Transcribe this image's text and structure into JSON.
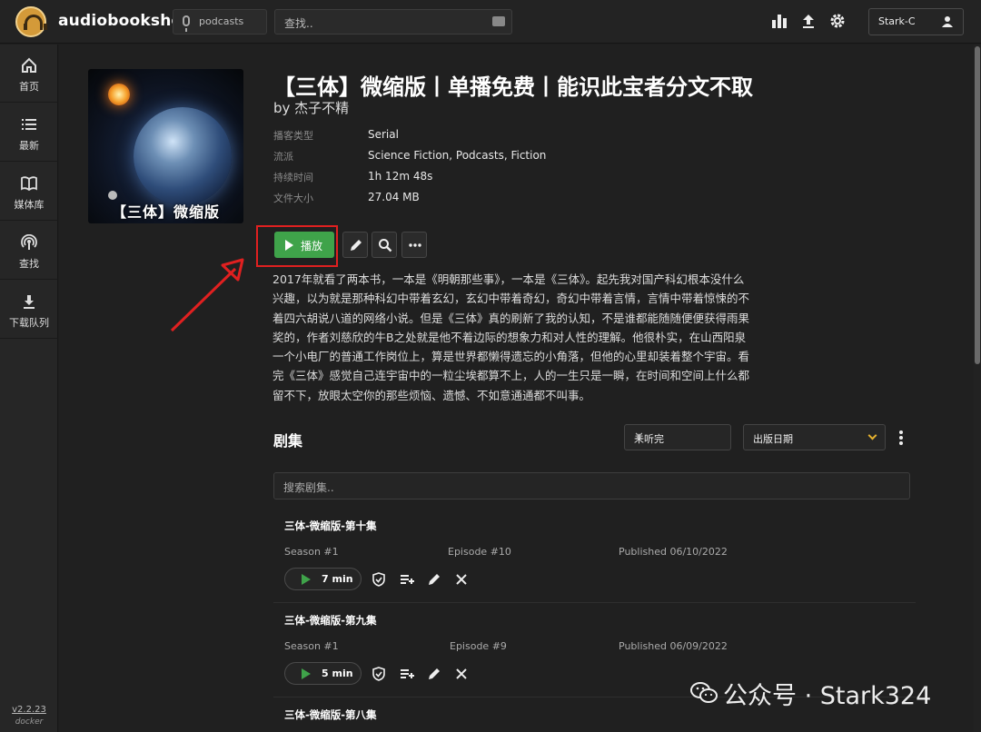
{
  "app": {
    "title": "audiobookshelf",
    "version": "v2.2.23",
    "platform": "docker"
  },
  "topbar": {
    "library": "podcasts",
    "search_placeholder": "查找..",
    "user": "Stark-C"
  },
  "sidebar": {
    "items": [
      {
        "label": "首页",
        "icon": "home-icon"
      },
      {
        "label": "最新",
        "icon": "list-icon"
      },
      {
        "label": "媒体库",
        "icon": "book-icon"
      },
      {
        "label": "查找",
        "icon": "podcast-search-icon"
      },
      {
        "label": "下载队列",
        "icon": "download-icon"
      }
    ]
  },
  "podcast": {
    "cover_caption": "【三体】微缩版",
    "title": "【三体】微缩版丨单播免费丨能识此宝者分文不取",
    "author": "by 杰子不精",
    "meta": [
      {
        "key": "播客类型",
        "value": "Serial"
      },
      {
        "key": "流派",
        "value": "Science Fiction, Podcasts, Fiction"
      },
      {
        "key": "持续时间",
        "value": "1h 12m 48s"
      },
      {
        "key": "文件大小",
        "value": "27.04 MB"
      }
    ],
    "play_label": "播放",
    "description_lines": [
      "2017年就看了两本书，一本是《明朝那些事》，一本是《三体》。起先我对国产科幻根本没什么",
      "兴趣，以为就是那种科幻中带着玄幻，玄幻中带着奇幻，奇幻中带着言情，言情中带着惊悚的不",
      "着四六胡说八道的网络小说。但是《三体》真的刷新了我的认知，不是谁都能随随便便获得雨果",
      "奖的，作者刘慈欣的牛B之处就是他不着边际的想象力和对人性的理解。他很朴实，在山西阳泉",
      "一个小电厂的普通工作岗位上，算是世界都懒得遗忘的小角落，但他的心里却装着整个宇宙。看",
      "完《三体》感觉自己连宇宙中的一粒尘埃都算不上，人的一生只是一瞬，在时间和空间上什么都",
      "留不下，放眼太空你的那些烦恼、遗憾、不如意通通都不叫事。"
    ]
  },
  "episodes": {
    "heading": "剧集",
    "filter": "未听完",
    "sort": "出版日期",
    "search_placeholder": "搜索剧集..",
    "items": [
      {
        "title": "三体-微缩版-第十集",
        "season": "Season #1",
        "episode": "Episode #10",
        "published": "Published 06/10/2022",
        "duration": "7 min"
      },
      {
        "title": "三体-微缩版-第九集",
        "season": "Season #1",
        "episode": "Episode #9",
        "published": "Published 06/09/2022",
        "duration": "5 min"
      },
      {
        "title": "三体-微缩版-第八集"
      }
    ]
  },
  "watermark": "公众号 · Stark324",
  "colors": {
    "accent_green": "#3fa34a",
    "highlight_red": "#e02020",
    "sort_chevron": "#e5b12e"
  }
}
